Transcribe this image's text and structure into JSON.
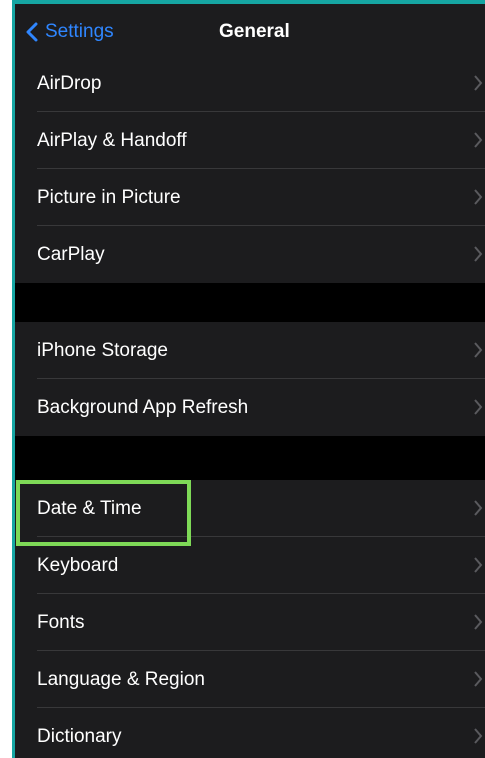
{
  "nav": {
    "back_label": "Settings",
    "title": "General"
  },
  "groups": [
    {
      "items": [
        {
          "label": "AirDrop"
        },
        {
          "label": "AirPlay & Handoff"
        },
        {
          "label": "Picture in Picture"
        },
        {
          "label": "CarPlay"
        }
      ]
    },
    {
      "items": [
        {
          "label": "iPhone Storage"
        },
        {
          "label": "Background App Refresh"
        }
      ]
    },
    {
      "items": [
        {
          "label": "Date & Time",
          "highlighted": true
        },
        {
          "label": "Keyboard"
        },
        {
          "label": "Fonts"
        },
        {
          "label": "Language & Region"
        },
        {
          "label": "Dictionary"
        }
      ]
    }
  ],
  "colors": {
    "accent": "#2f86ff",
    "row_background": "#1c1c1e",
    "screen_background": "#000000",
    "highlight_border": "#7ed957",
    "frame_edge": "#16a6a3"
  },
  "icons": {
    "back": "chevron-left-icon",
    "disclosure": "chevron-right-icon"
  }
}
